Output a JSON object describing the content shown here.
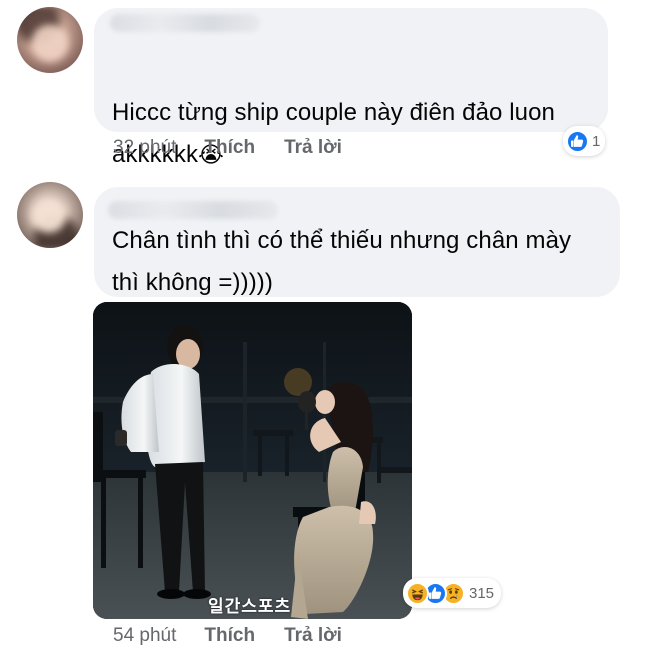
{
  "comments": [
    {
      "text": "Hiccc từng ship couple này điên đảo luon\nakkkkkk",
      "emoji": "😭",
      "time": "32 phút",
      "like_label": "Thích",
      "reply_label": "Trả lời",
      "reaction_count": "1",
      "reactions": [
        "like-icon"
      ]
    },
    {
      "text": "Chân tình thì có thể thiếu nhưng chân mày\nthì không =)))))",
      "time": "54 phút",
      "like_label": "Thích",
      "reply_label": "Trả lời",
      "reaction_count": "315",
      "reactions": [
        "haha-icon",
        "like-icon",
        "sad-icon"
      ],
      "photo": {
        "watermark": "일간스포츠"
      }
    }
  ],
  "colors": {
    "bubble": "#f0f2f5",
    "text": "#050505",
    "meta": "#65676b",
    "like_blue": "#1877f2",
    "reaction_yellow": "#f7b125"
  }
}
